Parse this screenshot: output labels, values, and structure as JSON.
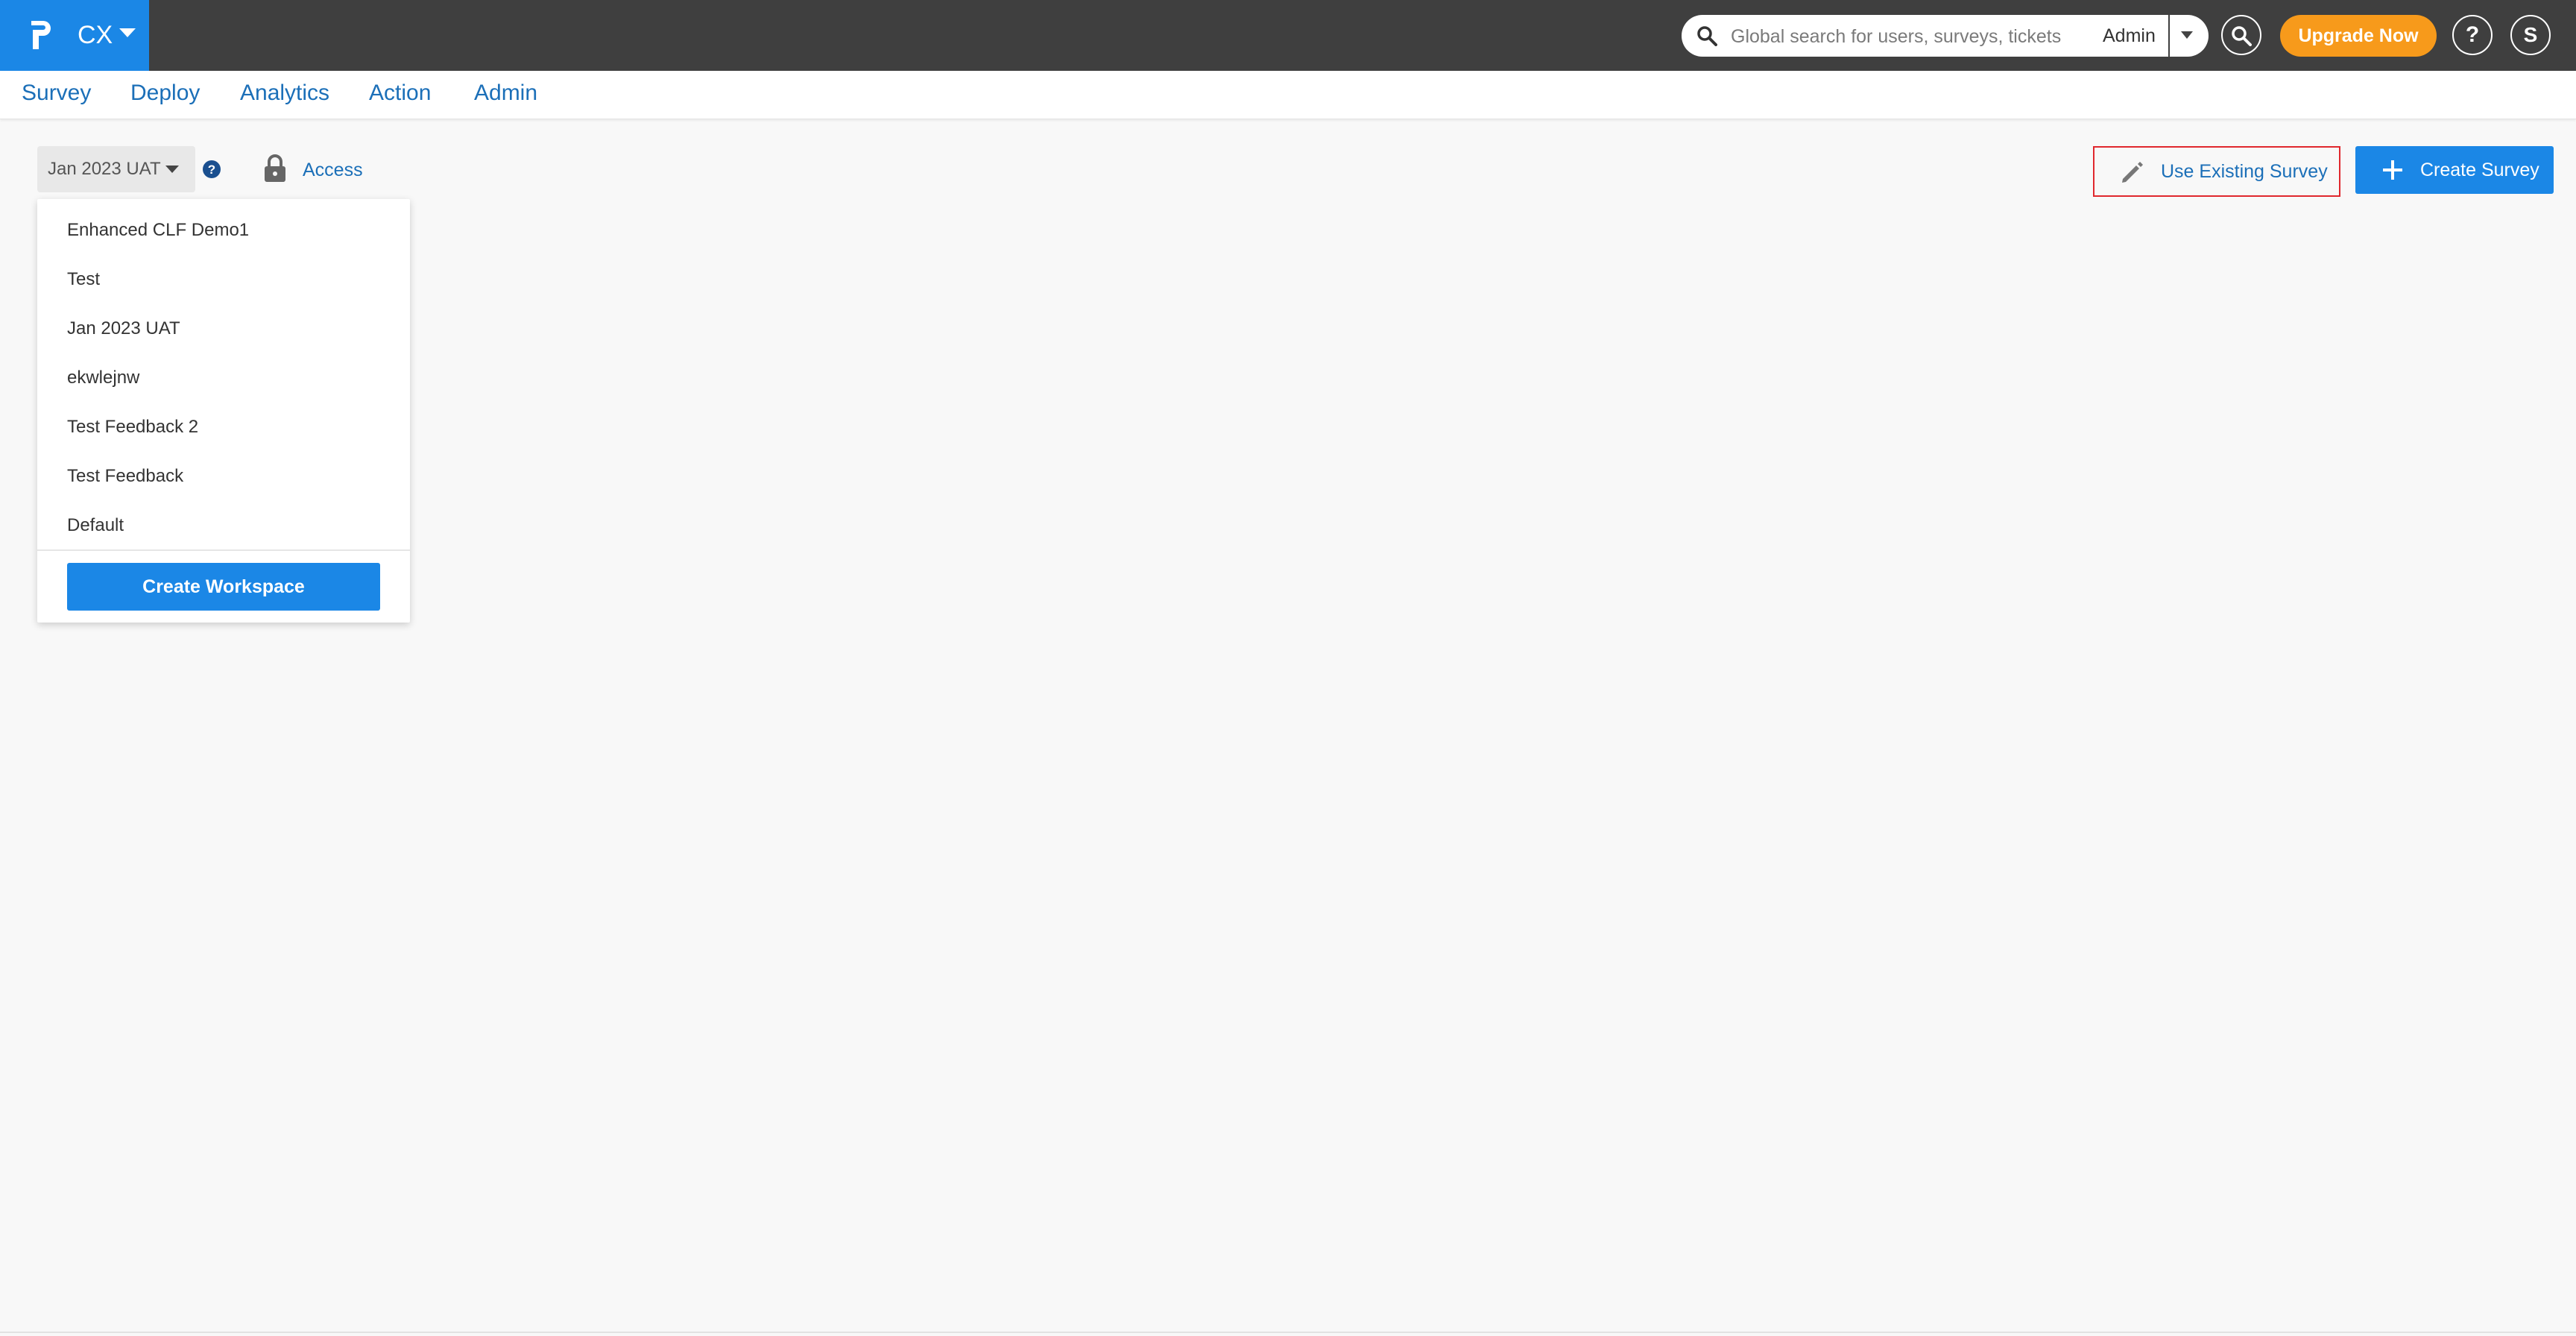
{
  "header": {
    "app_name": "CX",
    "search": {
      "placeholder": "Global search for users, surveys, tickets",
      "scope": "Admin"
    },
    "upgrade_label": "Upgrade Now",
    "help_label": "?",
    "user_initial": "S"
  },
  "nav": {
    "items": [
      {
        "label": "Survey"
      },
      {
        "label": "Deploy"
      },
      {
        "label": "Analytics"
      },
      {
        "label": "Action"
      },
      {
        "label": "Admin"
      }
    ]
  },
  "toolbar": {
    "workspace_selected": "Jan 2023 UAT",
    "access_label": "Access",
    "use_existing_label": "Use Existing Survey",
    "create_survey_label": "Create Survey"
  },
  "workspace_dropdown": {
    "options": [
      "Enhanced CLF Demo1",
      "Test",
      "Jan 2023 UAT",
      "ekwlejnw",
      "Test Feedback 2",
      "Test Feedback",
      "Default"
    ],
    "create_label": "Create Workspace"
  },
  "colors": {
    "brand": "#1b87e6",
    "topbar": "#3f3f3f",
    "upgrade": "#f79a1b",
    "link": "#1b6fb8",
    "highlight_border": "#e0282e"
  },
  "icons": [
    "logo-icon",
    "chevron-down-icon",
    "search-icon",
    "help-icon",
    "lock-icon",
    "pencil-icon",
    "plus-icon"
  ]
}
